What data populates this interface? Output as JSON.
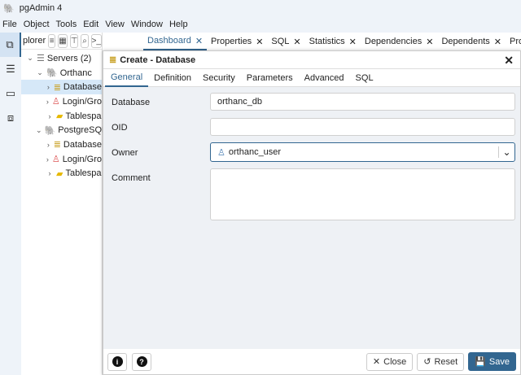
{
  "app": {
    "title": "pgAdmin 4"
  },
  "menu": [
    "File",
    "Object",
    "Tools",
    "Edit",
    "View",
    "Window",
    "Help"
  ],
  "tree": {
    "header": "plorer",
    "nodes": [
      "Servers (2)",
      "Orthanc",
      "Database",
      "Login/Gro",
      "Tablespa",
      "PostgreSQL",
      "Database",
      "Login/Gro",
      "Tablespa"
    ]
  },
  "tabs": [
    "Dashboard",
    "Properties",
    "SQL",
    "Statistics",
    "Dependencies",
    "Dependents",
    "Process"
  ],
  "dialog": {
    "title": "Create - Database",
    "tabs": [
      "General",
      "Definition",
      "Security",
      "Parameters",
      "Advanced",
      "SQL"
    ],
    "fields": {
      "database_label": "Database",
      "database_value": "orthanc_db",
      "oid_label": "OID",
      "oid_value": "",
      "owner_label": "Owner",
      "owner_value": "orthanc_user",
      "comment_label": "Comment",
      "comment_value": ""
    },
    "buttons": {
      "close": "Close",
      "reset": "Reset",
      "save": "Save"
    }
  },
  "colors": {
    "accent": "#326690",
    "save": "#326690"
  }
}
